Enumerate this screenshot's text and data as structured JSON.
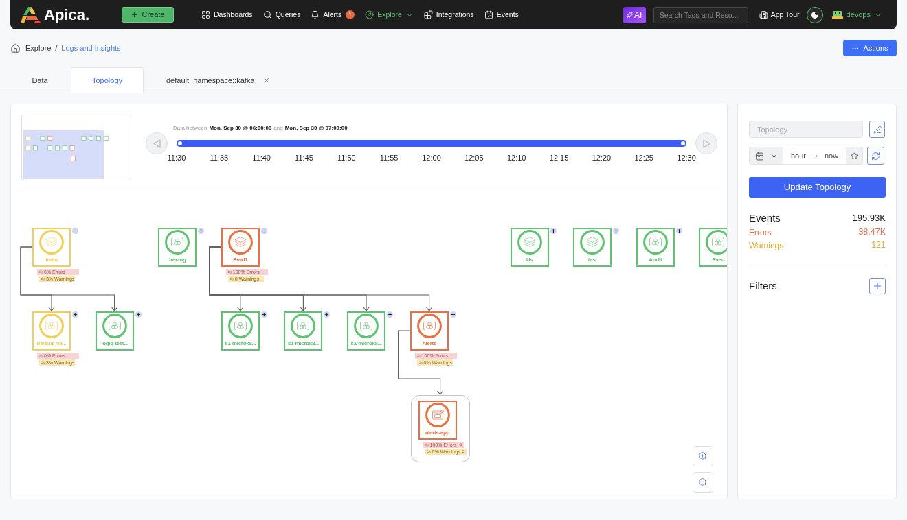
{
  "nav": {
    "brand": "Apica.",
    "create": "Create",
    "items": [
      {
        "label": "Dashboards",
        "selected": false,
        "menu": false
      },
      {
        "label": "Queries",
        "selected": false,
        "menu": false
      },
      {
        "label": "Alerts",
        "selected": false,
        "menu": false,
        "count": "1"
      },
      {
        "label": "Explore",
        "selected": true,
        "menu": true
      },
      {
        "label": "Integrations",
        "selected": false,
        "menu": false
      },
      {
        "label": "Events",
        "selected": false,
        "menu": false
      }
    ],
    "ai": "AI",
    "search": {
      "placeholder": "Search Tags and Reso..."
    },
    "tour": "App Tour",
    "user": "devops"
  },
  "breadcrumb": {
    "items": [
      {
        "label": "Explore",
        "link": false
      },
      {
        "label": "Logs and Insights",
        "link": true
      }
    ],
    "separator": "/"
  },
  "actions": "Actions",
  "tabs": [
    {
      "label": "Data",
      "selected": false,
      "closable": false
    },
    {
      "label": "Topology",
      "selected": true,
      "closable": false
    },
    {
      "label": "default_namespace::kafka",
      "selected": false,
      "closable": true
    }
  ],
  "timeline": {
    "prefix": "Data between",
    "start": "Mon, Sep 30 @ 06:00:00",
    "joiner": "and",
    "end": "Mon, Sep 30 @ 07:00:00",
    "level": 1,
    "ticks": [
      "11:30",
      "11:35",
      "11:40",
      "11:45",
      "11:50",
      "11:55",
      "12:00",
      "12:05",
      "12:10",
      "12:15",
      "12:20",
      "12:25",
      "12:30"
    ]
  },
  "topology": {
    "nodes": [
      {
        "label": "India",
        "kind": "stack",
        "color": "#f5cf55",
        "expanded": true,
        "errors": "0% Errors",
        "warnings": "3% Warnings",
        "children": [
          {
            "label": "default_na...",
            "kind": "cluster",
            "color": "#f5cf55",
            "expanded": false,
            "errors": "0% Errors",
            "warnings": "3% Warnings"
          },
          {
            "label": "logiq-test...",
            "kind": "cluster",
            "color": "#5cc46f",
            "expanded": false
          }
        ]
      },
      {
        "label": "tracing",
        "kind": "cluster",
        "color": "#5cc46f",
        "expanded": false
      },
      {
        "label": "Prod1",
        "kind": "stack",
        "color": "#e9703f",
        "expanded": true,
        "errors": "100% Errors",
        "warnings": "0 Warnings",
        "children": [
          {
            "label": "s1-microk8...",
            "kind": "cluster",
            "color": "#5cc46f",
            "expanded": false
          },
          {
            "label": "s1-microk8...",
            "kind": "cluster",
            "color": "#5cc46f",
            "expanded": false
          },
          {
            "label": "s1-microk8...",
            "kind": "cluster",
            "color": "#5cc46f",
            "expanded": false
          },
          {
            "label": "Alerts",
            "kind": "cluster",
            "color": "#e9703f",
            "expanded": true,
            "errors": "100% Errors",
            "warnings": "0% Warnings",
            "children": [
              {
                "label": "alerts-app",
                "kind": "app",
                "color": "#e9703f",
                "errors": "100% Errors",
                "warnings": "0% Warnings"
              }
            ]
          }
        ]
      },
      {
        "label": "Us",
        "kind": "stack",
        "color": "#5cc46f",
        "expanded": false
      },
      {
        "label": "test",
        "kind": "stack",
        "color": "#5cc46f",
        "expanded": false
      },
      {
        "label": "Audit",
        "kind": "cluster",
        "color": "#5cc46f",
        "expanded": false
      },
      {
        "label": "Even",
        "kind": "cluster",
        "color": "#5cc46f"
      }
    ]
  },
  "panel": {
    "name": {
      "placeholder": "Topology"
    },
    "range": {
      "from": "hour",
      "to": "now"
    },
    "update": "Update Topology",
    "stats": [
      {
        "label": "Events",
        "value": "195.93K",
        "kind": "total"
      },
      {
        "label": "Errors",
        "value": "38.47K",
        "kind": "error"
      },
      {
        "label": "Warnings",
        "value": "121",
        "kind": "warning"
      }
    ],
    "filters": "Filters"
  }
}
